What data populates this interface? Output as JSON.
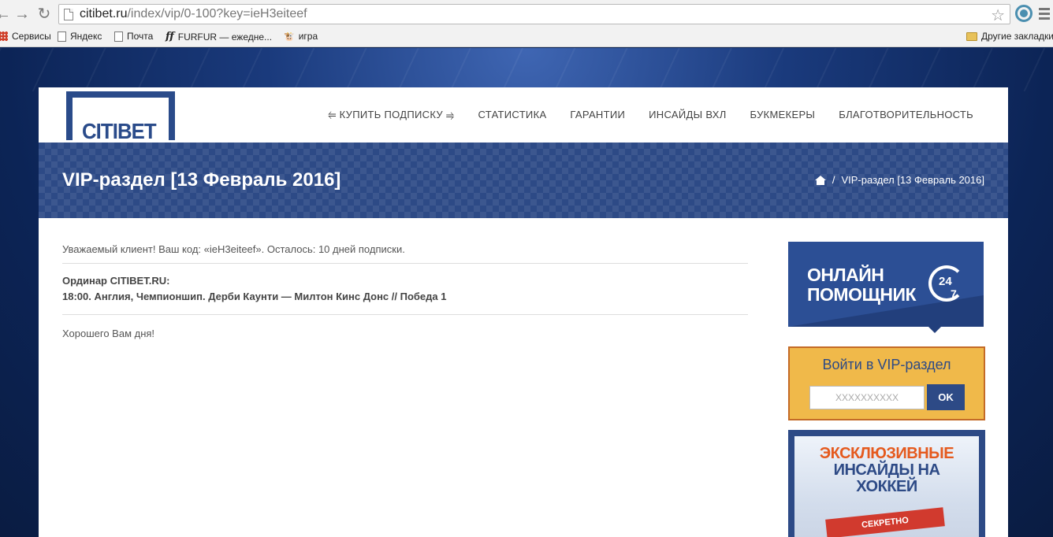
{
  "browser": {
    "url_host": "citibet.ru",
    "url_path": "/index/vip/0-100?key=ieH3eiteef"
  },
  "bookmarks": [
    {
      "label": "Сервисы",
      "icon": "apps-grid-icon"
    },
    {
      "label": "Яндекс",
      "icon": "page-icon"
    },
    {
      "label": "Почта",
      "icon": "page-icon"
    },
    {
      "label": "FURFUR — ежедне...",
      "icon": "furfur-icon"
    },
    {
      "label": "игра",
      "icon": "game-icon"
    }
  ],
  "bookmarks_other": "Другие закладки",
  "site": {
    "logo": "CITIBET",
    "nav": [
      "⥢ КУПИТЬ ПОДПИСКУ ⥤",
      "СТАТИСТИКА",
      "ГАРАНТИИ",
      "ИНСАЙДЫ ВХЛ",
      "БУКМЕКЕРЫ",
      "БЛАГОТВОРИТЕЛЬНОСТЬ"
    ],
    "page_title": "VIP-раздел [13 Февраль 2016]",
    "breadcrumb": {
      "separator": "/",
      "current": "VIP-раздел [13 Февраль 2016]"
    }
  },
  "content": {
    "greeting": "Уважаемый клиент! Ваш код: «ieH3eiteef». Осталось: 10 дней подписки.",
    "bet_title": "Ординар CITIBET.RU:",
    "bet_line": "18:00. Англия, Чемпионшип. Дерби Каунти — Милтон Кинс Донс // Победа 1",
    "farewell": "Хорошего Вам дня!"
  },
  "sidebar": {
    "helper_line1": "ОНЛАЙН",
    "helper_line2": "ПОМОЩНИК",
    "helper_badge_top": "24",
    "helper_badge_bottom": "7",
    "vip_title": "Войти в VIP-раздел",
    "vip_placeholder": "XXXXXXXXXX",
    "vip_button": "OK",
    "promo_line1": "ЭКСКЛЮЗИВНЫЕ",
    "promo_line2": "ИНСАЙДЫ НА",
    "promo_line3": "ХОККЕЙ",
    "promo_stamp": "СЕКРЕТНО"
  },
  "colors": {
    "brand_blue": "#2d4a86",
    "vip_gold": "#f0b94a",
    "vip_border": "#c46a27",
    "promo_orange": "#e55a1e"
  }
}
